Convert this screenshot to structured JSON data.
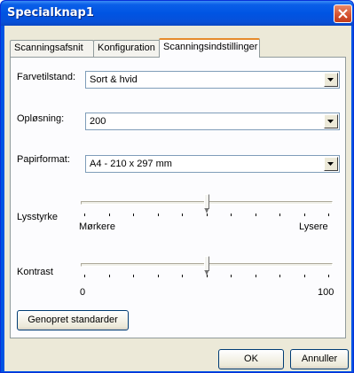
{
  "window": {
    "title": "Specialknap1"
  },
  "tabs": [
    {
      "label": "Scanningsafsnit"
    },
    {
      "label": "Konfiguration"
    },
    {
      "label": "Scanningsindstillinger"
    }
  ],
  "settings": {
    "color_mode": {
      "label": "Farvetilstand:",
      "value": "Sort & hvid"
    },
    "resolution": {
      "label": "Opløsning:",
      "value": "200"
    },
    "paper_size": {
      "label": "Papirformat:",
      "value": "A4 - 210 x 297 mm"
    },
    "brightness": {
      "label": "Lysstyrke",
      "min_label": "Mørkere",
      "max_label": "Lysere",
      "position": 0.5
    },
    "contrast": {
      "label": "Kontrast",
      "min_label": "0",
      "max_label": "100",
      "position": 0.5
    }
  },
  "buttons": {
    "restore_defaults": "Genopret standarder",
    "ok": "OK",
    "cancel": "Annuller"
  },
  "icons": {
    "close": "close-icon",
    "dropdown": "chevron-down-icon"
  }
}
